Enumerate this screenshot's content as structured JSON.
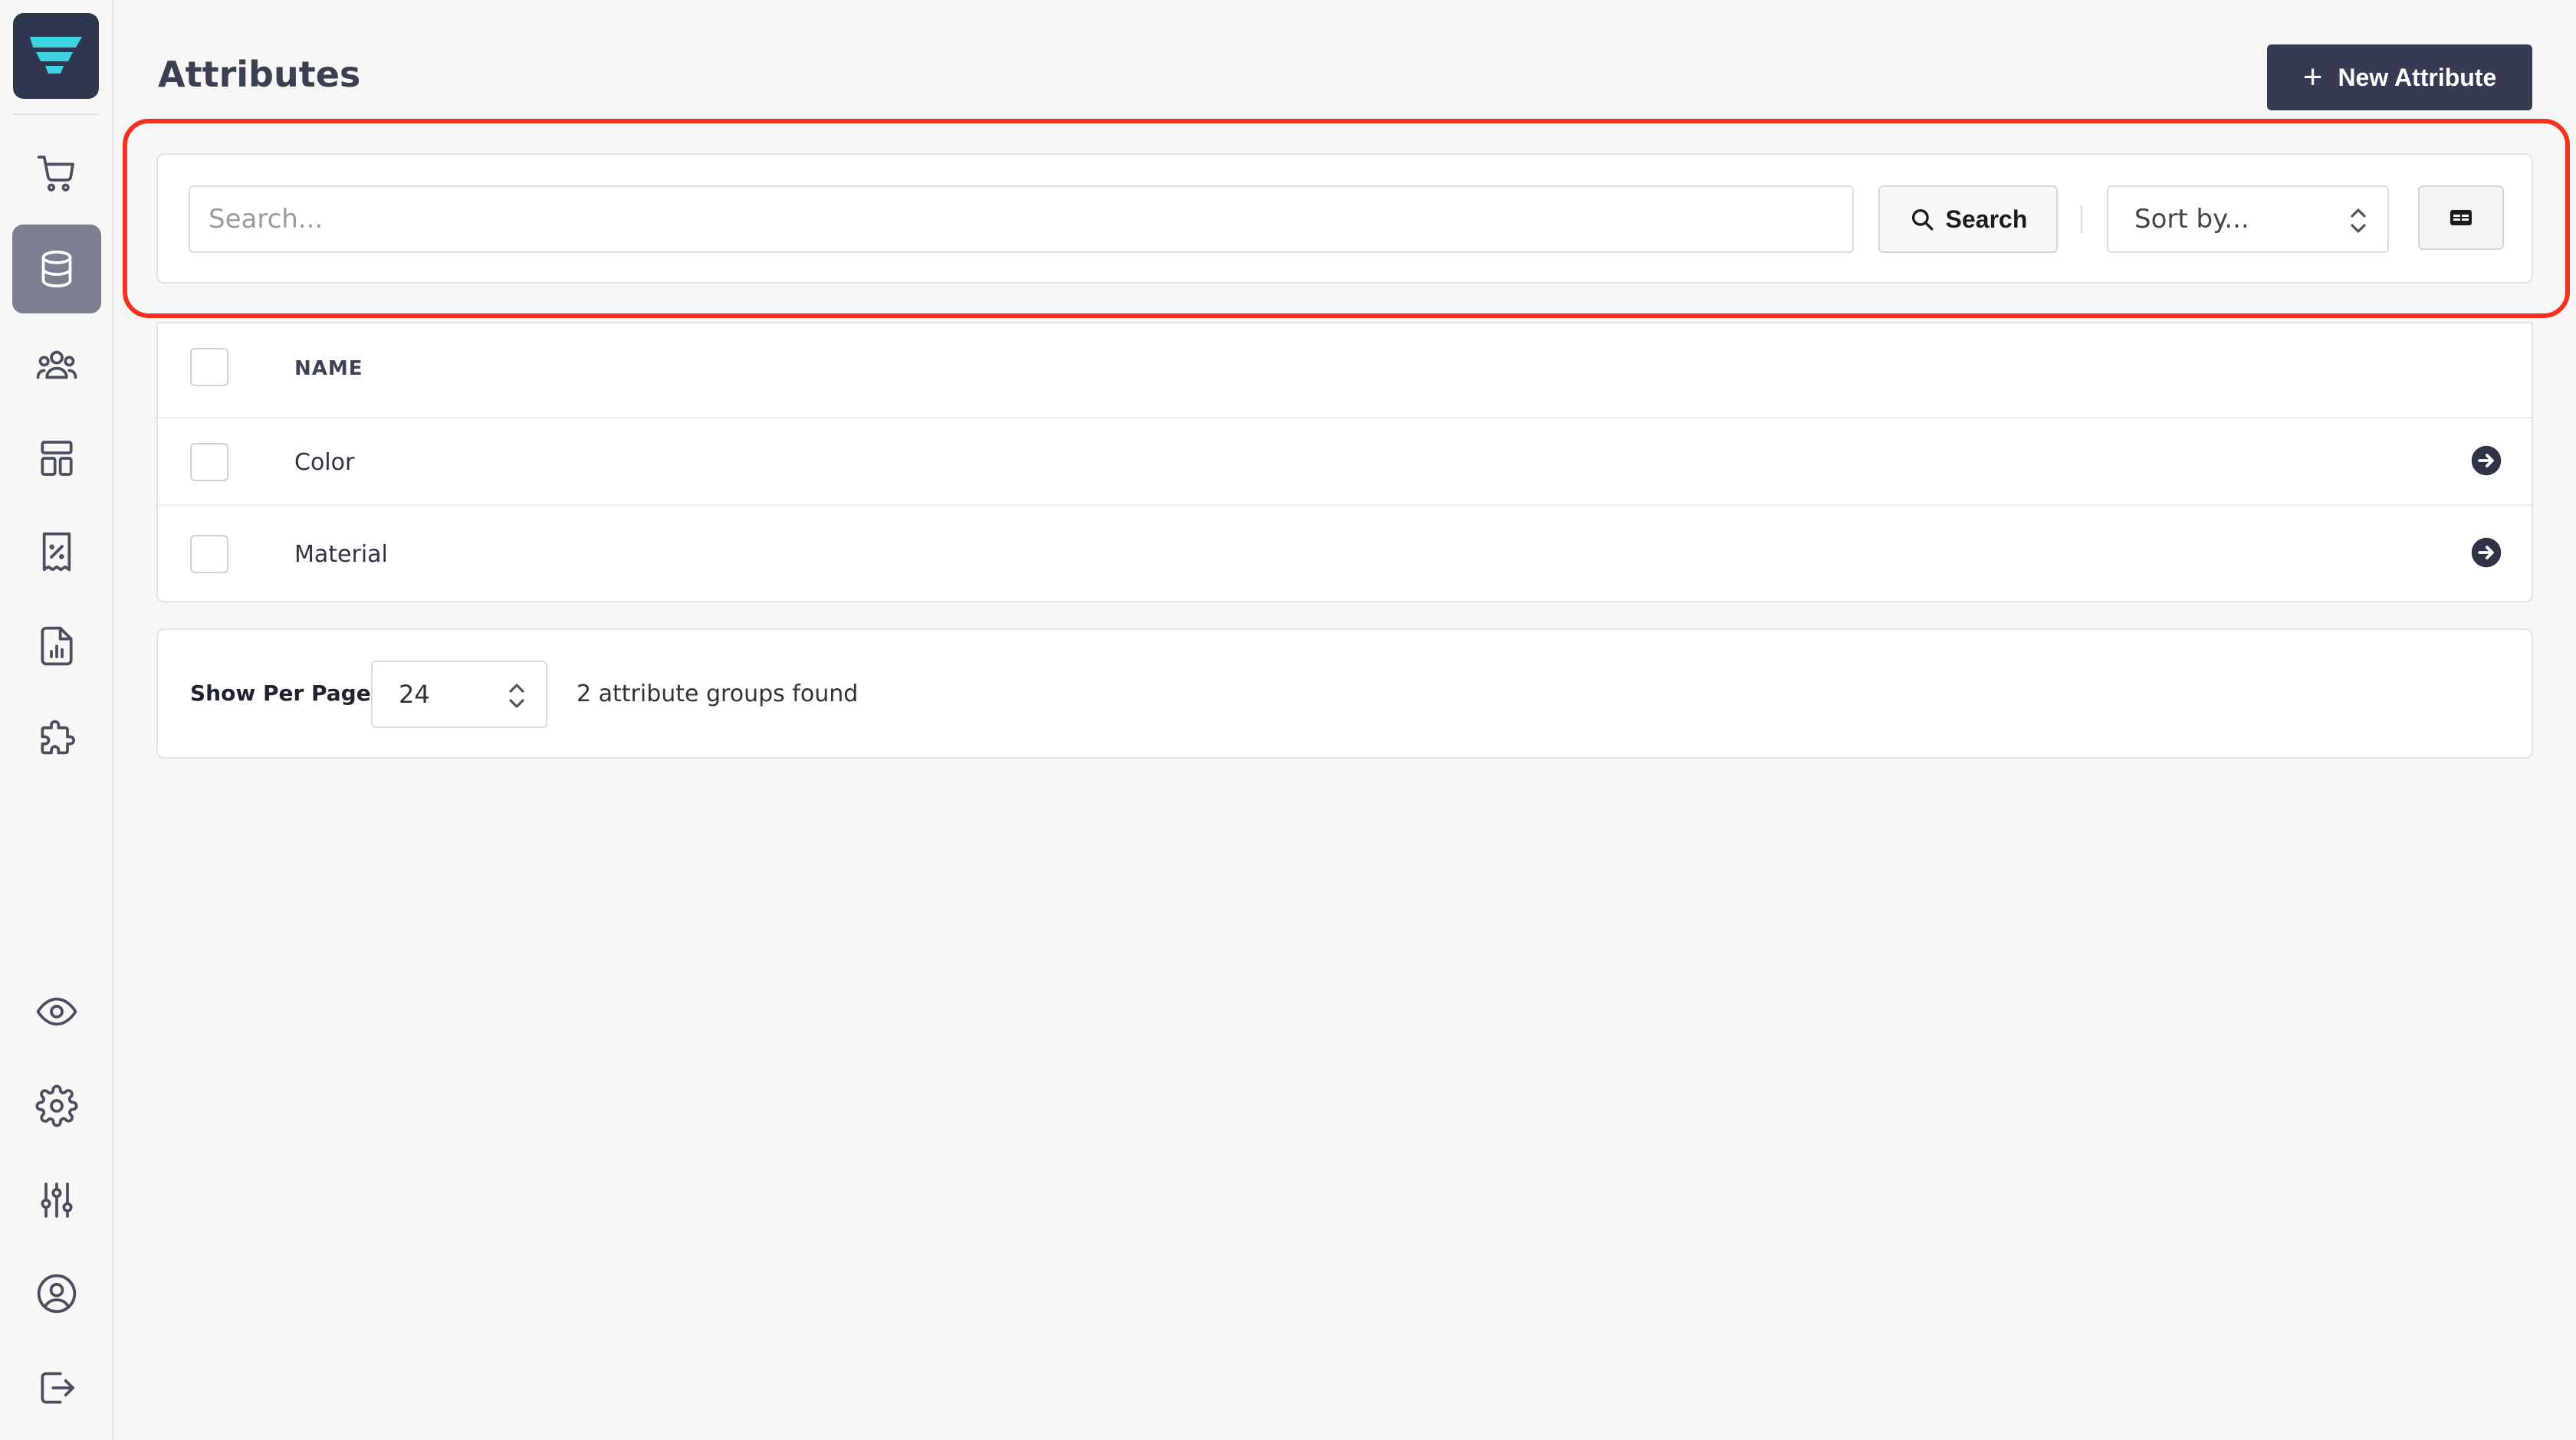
{
  "page": {
    "title": "Attributes"
  },
  "header": {
    "new_button_label": "New Attribute"
  },
  "search": {
    "placeholder": "Search...",
    "value": "",
    "button_label": "Search"
  },
  "sort": {
    "selected": "Sort by..."
  },
  "table": {
    "columns": [
      "NAME"
    ],
    "rows": [
      {
        "name": "Color"
      },
      {
        "name": "Material"
      }
    ]
  },
  "pagination": {
    "per_page_label": "Show Per Page",
    "per_page_value": "24",
    "found_text": "2 attribute groups found"
  },
  "sidebar": {
    "items": [
      {
        "icon": "cart-icon"
      },
      {
        "icon": "database-icon",
        "active": true
      },
      {
        "icon": "users-icon"
      },
      {
        "icon": "layout-icon"
      },
      {
        "icon": "receipt-percent-icon"
      },
      {
        "icon": "report-icon"
      },
      {
        "icon": "puzzle-icon"
      },
      {
        "icon": "eye-icon"
      },
      {
        "icon": "gear-icon"
      },
      {
        "icon": "sliders-icon"
      },
      {
        "icon": "user-circle-icon"
      },
      {
        "icon": "logout-icon"
      }
    ]
  },
  "colors": {
    "primary": "#363a52",
    "highlight": "#f2321d",
    "active_nav": "#7b7f8f",
    "logo_accent": "#3fd3e0"
  }
}
